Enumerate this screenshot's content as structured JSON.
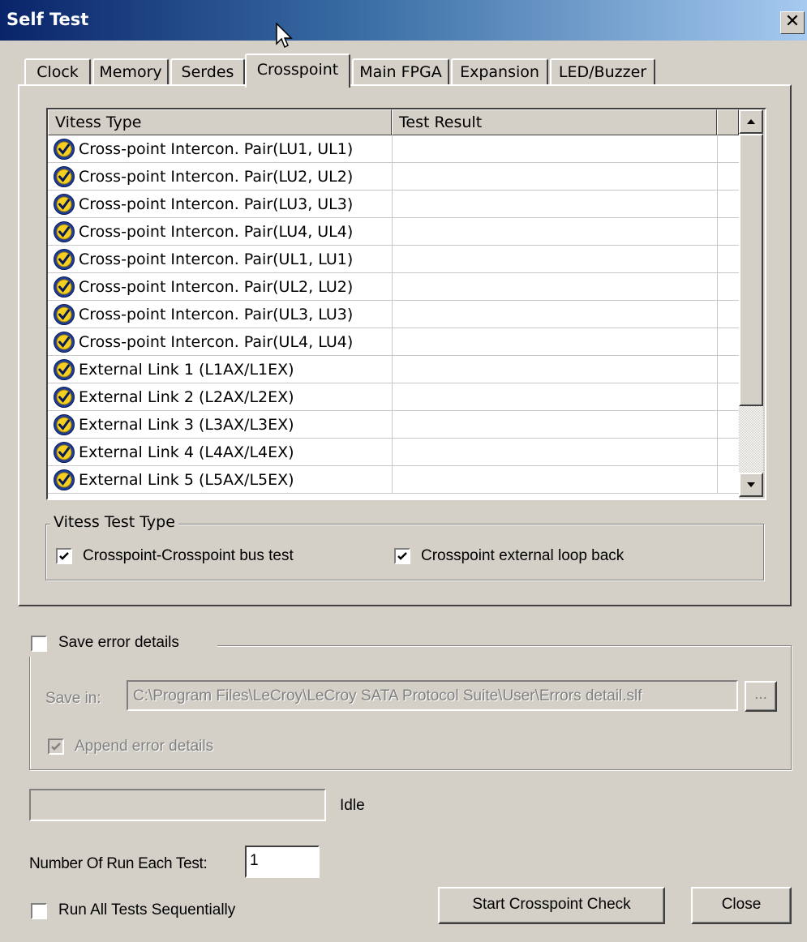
{
  "window": {
    "title": "Self Test",
    "close_glyph": "✕"
  },
  "tabs": [
    {
      "label": "Clock"
    },
    {
      "label": "Memory"
    },
    {
      "label": "Serdes"
    },
    {
      "label": "Crosspoint"
    },
    {
      "label": "Main FPGA"
    },
    {
      "label": "Expansion"
    },
    {
      "label": "LED/Buzzer"
    }
  ],
  "active_tab": "Crosspoint",
  "table": {
    "columns": [
      "Vitess Type",
      "Test Result"
    ],
    "rows": [
      {
        "name": "Cross-point Intercon. Pair(LU1, UL1)",
        "result": "",
        "icon": "check-shield-icon"
      },
      {
        "name": "Cross-point Intercon. Pair(LU2, UL2)",
        "result": "",
        "icon": "check-shield-icon"
      },
      {
        "name": "Cross-point Intercon. Pair(LU3, UL3)",
        "result": "",
        "icon": "check-shield-icon"
      },
      {
        "name": "Cross-point Intercon. Pair(LU4, UL4)",
        "result": "",
        "icon": "check-shield-icon"
      },
      {
        "name": "Cross-point Intercon. Pair(UL1, LU1)",
        "result": "",
        "icon": "check-shield-icon"
      },
      {
        "name": "Cross-point Intercon. Pair(UL2, LU2)",
        "result": "",
        "icon": "check-shield-icon"
      },
      {
        "name": "Cross-point Intercon. Pair(UL3, LU3)",
        "result": "",
        "icon": "check-shield-icon"
      },
      {
        "name": "Cross-point Intercon. Pair(UL4, LU4)",
        "result": "",
        "icon": "check-shield-icon"
      },
      {
        "name": "External Link 1 (L1AX/L1EX)",
        "result": "",
        "icon": "check-shield-icon"
      },
      {
        "name": "External Link 2 (L2AX/L2EX)",
        "result": "",
        "icon": "check-shield-icon"
      },
      {
        "name": "External Link 3 (L3AX/L3EX)",
        "result": "",
        "icon": "check-shield-icon"
      },
      {
        "name": "External Link 4 (L4AX/L4EX)",
        "result": "",
        "icon": "check-shield-icon"
      },
      {
        "name": "External Link 5 (L5AX/L5EX)",
        "result": "",
        "icon": "check-shield-icon"
      }
    ]
  },
  "vitess_test_type": {
    "legend": "Vitess Test Type",
    "options": [
      {
        "label": "Crosspoint-Crosspoint bus test",
        "checked": true
      },
      {
        "label": "Crosspoint external loop back",
        "checked": true
      }
    ]
  },
  "save_error": {
    "label": "Save error details",
    "checked": false,
    "save_in_label": "Save in:",
    "path": "C:\\Program Files\\LeCroy\\LeCroy SATA Protocol Suite\\User\\Errors detail.slf",
    "browse_label": "...",
    "append_label": "Append error details",
    "append_checked": true
  },
  "progress": {
    "value": 0,
    "status": "Idle"
  },
  "run_count": {
    "label": "Number Of Run Each Test:",
    "value": "1"
  },
  "run_all": {
    "label": "Run All Tests Sequentially",
    "checked": false
  },
  "buttons": {
    "start": "Start Crosspoint Check",
    "close": "Close"
  }
}
